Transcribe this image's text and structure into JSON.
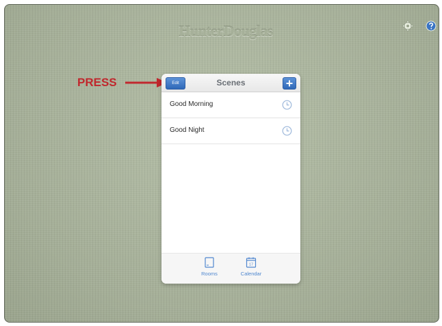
{
  "app": {
    "logo_text": "HunterDouglas"
  },
  "toolbar_icons": [
    "gear-icon",
    "help-icon"
  ],
  "annotation": {
    "label": "PRESS",
    "color": "#c0272d"
  },
  "panel": {
    "edit_label": "Edit",
    "title": "Scenes",
    "add_icon": "plus-icon",
    "scenes": [
      {
        "name": "Good Morning",
        "icon": "clock-icon"
      },
      {
        "name": "Good Night",
        "icon": "clock-icon"
      }
    ],
    "tabs": [
      {
        "label": "Rooms",
        "icon": "rooms-icon"
      },
      {
        "label": "Calendar",
        "icon": "calendar-icon",
        "day": "17"
      }
    ]
  },
  "colors": {
    "accent": "#3a74c4",
    "background": "#a9b39c"
  }
}
